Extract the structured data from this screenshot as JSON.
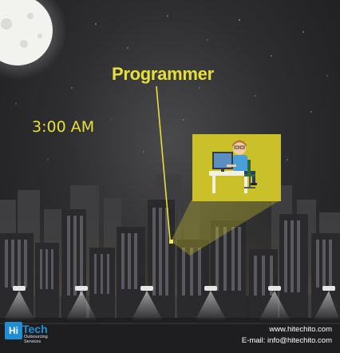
{
  "labels": {
    "role": "Programmer",
    "time": "3:00 AM"
  },
  "footer": {
    "website": "www.hitechito.com",
    "email": "E-mail: info@hitechito.com"
  },
  "logo": {
    "mark": "Hi",
    "word": "Tech",
    "tagline": "Outsourcing Services"
  },
  "colors": {
    "accent": "#e8e03a",
    "logo": "#1e8fd6",
    "sky": "#2e2e30",
    "buildings": "#2a2a2c"
  },
  "icons": [
    "moon-icon",
    "programmer-at-desk-icon",
    "street-lamp-icon"
  ]
}
